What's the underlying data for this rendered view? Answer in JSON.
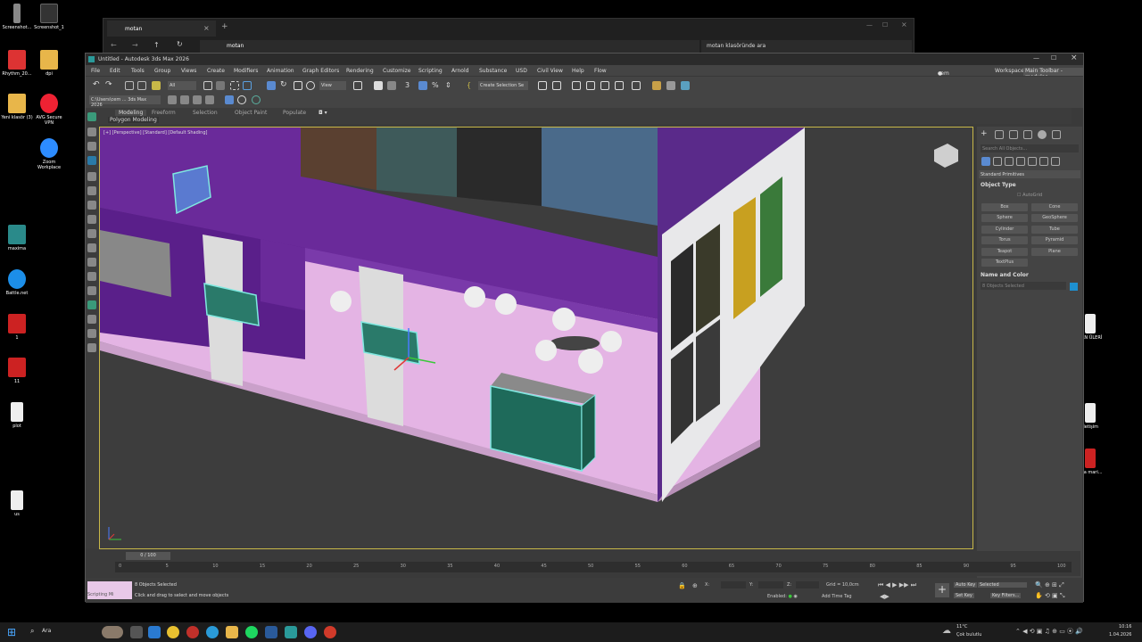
{
  "desktop": {
    "icons": [
      {
        "label": "Screenshot...",
        "color": "#888"
      },
      {
        "label": "Screenshot_1",
        "color": "#555"
      },
      {
        "label": "Rhythm_20...",
        "color": "#d33"
      },
      {
        "label": "dpi",
        "color": "#e8b64a"
      },
      {
        "label": "Yeni klasör (3)",
        "color": "#e8b64a"
      },
      {
        "label": "AVG Secure VPN",
        "color": "#e23"
      },
      {
        "label": "Zoom Workplace",
        "color": "#2d8cff"
      },
      {
        "label": "maxima",
        "color": "#3aa"
      },
      {
        "label": "Battle.net",
        "color": "#1c8ee8"
      },
      {
        "label": "1",
        "color": "#c22"
      },
      {
        "label": "11",
        "color": "#c22"
      },
      {
        "label": "plot",
        "color": "#eee"
      },
      {
        "label": "us",
        "color": "#eee"
      }
    ],
    "right_icons": [
      "RAN ÜLERİ",
      "iletişim",
      "ona mari..."
    ]
  },
  "explorer": {
    "tab_title": "motan",
    "address": "motan",
    "search_placeholder": "motan klasöründe ara"
  },
  "max": {
    "title": "Untitled - Autodesk 3ds Max 2026",
    "menus": [
      "File",
      "Edit",
      "Tools",
      "Group",
      "Views",
      "Create",
      "Modifiers",
      "Animation",
      "Graph Editors",
      "Rendering",
      "Customize",
      "Scripting",
      "Arnold",
      "Substance",
      "USD",
      "Civil View",
      "Help",
      "Flow"
    ],
    "user": "cem işmen",
    "workspaces_label": "Workspaces:",
    "workspace_value": "Main Toolbar - modular",
    "selection_filter": "All",
    "view_dropdown": "View",
    "create_selection_set": "Create Selection Se",
    "path": "C:\\Users\\cem ... 3ds Max 2026",
    "ribbon_tabs": [
      "Modeling",
      "Freeform",
      "Selection",
      "Object Paint",
      "Populate"
    ],
    "ribbon_sub": "Polygon Modeling",
    "viewport_label": "[+] [Perspective] [Standard] [Default Shading]"
  },
  "command_panel": {
    "search_placeholder": "Search All Objects...",
    "category": "Standard Primitives",
    "object_type_header": "Object Type",
    "autogrid": "AutoGrid",
    "buttons": [
      "Box",
      "Cone",
      "Sphere",
      "GeoSphere",
      "Cylinder",
      "Tube",
      "Torus",
      "Pyramid",
      "Teapot",
      "Plane",
      "TextPlus"
    ],
    "name_color_header": "Name and Color",
    "name_value": "8 Objects Selected",
    "swatch_color": "#1e90d0"
  },
  "timeline": {
    "frame_readout": "0 / 100",
    "ticks": [
      "0",
      "5",
      "10",
      "15",
      "20",
      "25",
      "30",
      "35",
      "40",
      "45",
      "50",
      "55",
      "60",
      "65",
      "70",
      "75",
      "80",
      "85",
      "90",
      "95",
      "100"
    ]
  },
  "status": {
    "script_label": "Scripting Mi",
    "selected": "8 Objects Selected",
    "prompt": "Click and drag to select and move objects",
    "x_label": "X:",
    "y_label": "Y:",
    "z_label": "Z:",
    "grid": "Grid = 10,0cm",
    "enabled": "Enabled:",
    "add_time_tag": "Add Time Tag",
    "auto_key": "Auto Key",
    "set_key": "Set Key",
    "selected_dropdown": "Selected",
    "key_filters": "Key Filters..."
  },
  "taskbar": {
    "search_label": "Ara",
    "weather_temp": "11°C",
    "weather_text": "Çok bulutlu",
    "time": "10:16",
    "date": "1.04.2026"
  }
}
